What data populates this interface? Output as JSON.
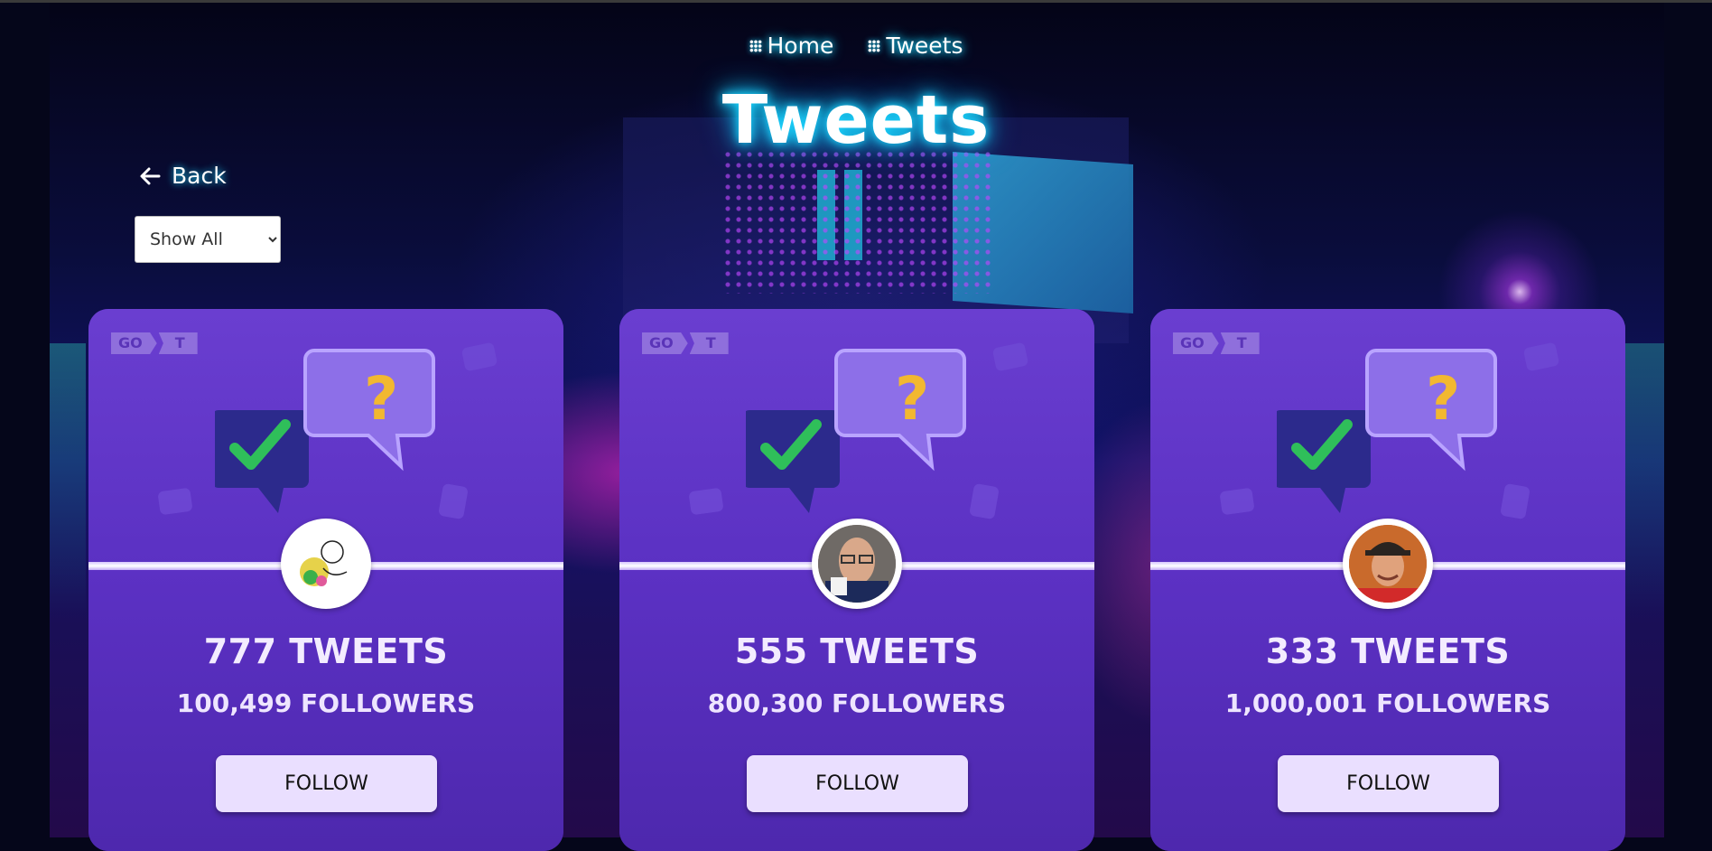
{
  "nav": {
    "links": [
      {
        "label": "Home",
        "icon": "grid-icon"
      },
      {
        "label": "Tweets",
        "icon": "grid-icon"
      }
    ]
  },
  "page": {
    "title": "Tweets",
    "back_label": "Back",
    "filter": {
      "selected": "Show All",
      "options": [
        "Show All"
      ]
    }
  },
  "cards": [
    {
      "badge_left": "GO",
      "badge_right": "T",
      "tweets": "777 TWEETS",
      "followers": "100,499 FOLLOWERS",
      "button": "FOLLOW",
      "avatar": "sketch-avatar"
    },
    {
      "badge_left": "GO",
      "badge_right": "T",
      "tweets": "555 TWEETS",
      "followers": "800,300 FOLLOWERS",
      "button": "FOLLOW",
      "avatar": "man-glasses-avatar"
    },
    {
      "badge_left": "GO",
      "badge_right": "T",
      "tweets": "333 TWEETS",
      "followers": "1,000,001 FOLLOWERS",
      "button": "FOLLOW",
      "avatar": "man-cap-avatar"
    }
  ],
  "colors": {
    "glow": "#1ad6ff",
    "card": "#5a2fc0",
    "button": "#eadfff"
  }
}
